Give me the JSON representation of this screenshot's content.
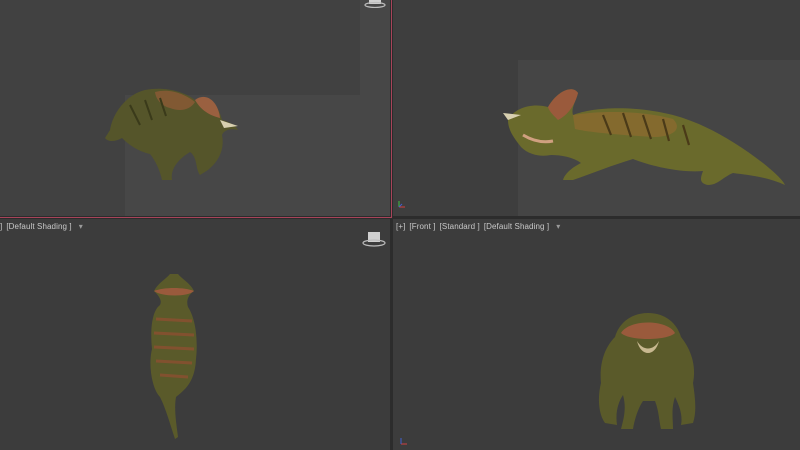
{
  "viewports": {
    "bottom_left": {
      "label_parts": [
        "]",
        "[Default Shading ]"
      ],
      "chevron": "▾"
    },
    "bottom_right": {
      "label_parts": [
        "[+]",
        "[Front ]",
        "[Standard ]",
        "[Default Shading ]"
      ],
      "chevron": "▾"
    }
  },
  "icons": {
    "viewcube": "viewcube-icon",
    "axis": "axis-gizmo-icon"
  },
  "colors": {
    "active_border": "#a8445a",
    "viewport_bg": "#3d3d3d",
    "creature_body": "#5a5a2a",
    "creature_stripes": "#9a5a3a"
  }
}
